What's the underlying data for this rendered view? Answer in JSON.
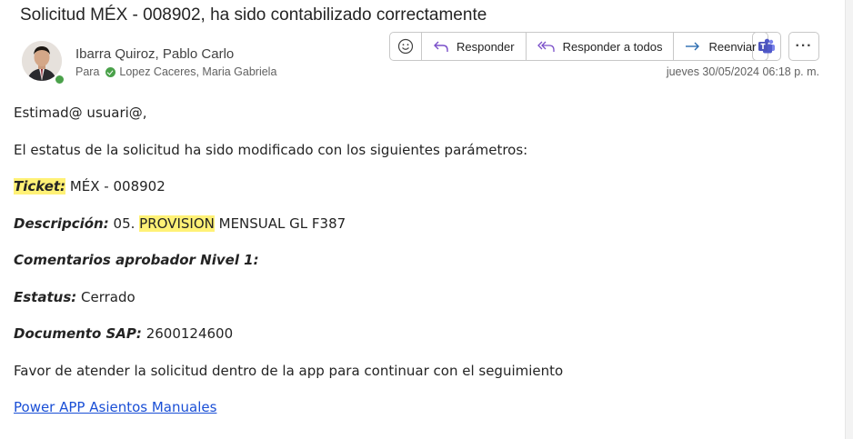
{
  "email": {
    "subject": "Solicitud MÉX - 008902, ha sido contabilizado correctamente",
    "sender": "Ibarra Quiroz, Pablo Carlo",
    "to_label": "Para",
    "recipient": "Lopez Caceres, Maria Gabriela",
    "date": "jueves 30/05/2024 06:18 p. m."
  },
  "toolbar": {
    "reply_label": "Responder",
    "reply_all_label": "Responder a todos",
    "forward_label": "Reenviar",
    "more_label": "···"
  },
  "body": {
    "greeting": "Estimad@ usuari@,",
    "intro": "El estatus de la solicitud ha sido modificado con los siguientes parámetros:",
    "ticket_label": "Ticket:",
    "ticket_value": "MÉX - 008902",
    "descripcion_label": "Descripción:",
    "descripcion_prefix": "05.",
    "descripcion_highlight": "PROVISION",
    "descripcion_suffix": "MENSUAL GL F387",
    "comentarios_label": "Comentarios aprobador Nivel 1:",
    "estatus_label": "Estatus:",
    "estatus_value": "Cerrado",
    "documento_label": "Documento SAP:",
    "documento_value": "2600124600",
    "closing": "Favor de atender la solicitud dentro de la app para continuar con el seguimiento",
    "link_text": "Power APP Asientos Manuales"
  },
  "colors": {
    "highlight": "#fff176",
    "link": "#1a4fd6",
    "presence": "#4aa14a",
    "teams": "#5059c9"
  },
  "icons": {
    "emoji": "smile-icon",
    "reply": "reply-arrow-icon",
    "reply_all": "reply-all-arrow-icon",
    "forward": "forward-arrow-icon",
    "teams": "teams-icon",
    "more": "more-horizontal-icon"
  }
}
